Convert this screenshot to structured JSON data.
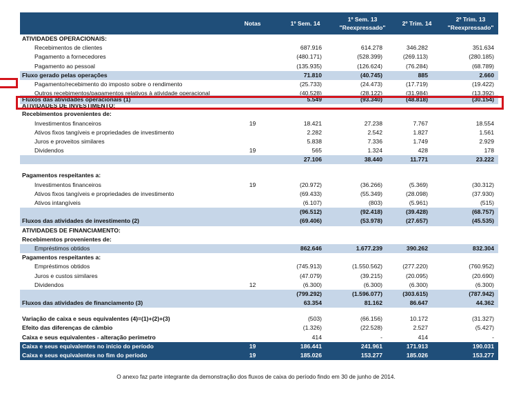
{
  "header": {
    "notes": "Notas",
    "c1": "1º Sem. 14",
    "c2_line1": "1º Sem. 13",
    "c2_line2": "\"Reexpressado\"",
    "c3": "2º Trim. 14",
    "c4_line1": "2º Trim. 13",
    "c4_line2": "\"Reexpressado\""
  },
  "rows": [
    {
      "style": "h",
      "label": "ATIVIDADES OPERACIONAIS:",
      "notes": "",
      "v": [
        "",
        "",
        "",
        ""
      ]
    },
    {
      "style": "",
      "indent": true,
      "label": "Recebimentos de clientes",
      "notes": "",
      "v": [
        "687.916",
        "614.278",
        "346.282",
        "351.634"
      ]
    },
    {
      "style": "",
      "indent": true,
      "label": "Pagamento a fornecedores",
      "notes": "",
      "v": [
        "(480.171)",
        "(528.399)",
        "(269.113)",
        "(280.185)"
      ]
    },
    {
      "style": "",
      "indent": true,
      "label": "Pagamento ao pessoal",
      "notes": "",
      "v": [
        "(135.935)",
        "(126.624)",
        "(76.284)",
        "(68.789)"
      ]
    },
    {
      "style": "b",
      "label": "Fluxo gerado pelas operações",
      "notes": "",
      "v": [
        "71.810",
        "(40.745)",
        "885",
        "2.660"
      ]
    },
    {
      "style": "",
      "indent": true,
      "label": "Pagamento/recebimento do imposto sobre o rendimento",
      "notes": "",
      "v": [
        "(25.733)",
        "(24.473)",
        "(17.719)",
        "(19.422)"
      ]
    },
    {
      "style": "clip",
      "indent": true,
      "label": "Outros recebimentos/pagamentos relativos à atividade operacional",
      "notes": "",
      "v": [
        "(40.528)",
        "(28.122)",
        "(31.984)",
        "(13.392)"
      ]
    },
    {
      "style": "b",
      "label": "Fluxos das atividades operacionais (1)",
      "notes": "",
      "v": [
        "5.549",
        "(93.340)",
        "(48.818)",
        "(30.154)"
      ]
    },
    {
      "style": "clip2",
      "label": "ATIVIDADES DE INVESTIMENTO:",
      "notes": "",
      "v": [
        "",
        "",
        "",
        ""
      ]
    },
    {
      "style": "h",
      "label": "Recebimentos provenientes de:",
      "notes": "",
      "v": [
        "",
        "",
        "",
        ""
      ]
    },
    {
      "style": "",
      "indent": true,
      "label": "Investimentos financeiros",
      "notes": "19",
      "v": [
        "18.421",
        "27.238",
        "7.767",
        "18.554"
      ]
    },
    {
      "style": "",
      "indent": true,
      "label": "Ativos fixos tangíveis e propriedades de investimento",
      "notes": "",
      "v": [
        "2.282",
        "2.542",
        "1.827",
        "1.561"
      ]
    },
    {
      "style": "",
      "indent": true,
      "label": "Juros e proveitos similares",
      "notes": "",
      "v": [
        "5.838",
        "7.336",
        "1.749",
        "2.929"
      ]
    },
    {
      "style": "",
      "indent": true,
      "label": "Dividendos",
      "notes": "19",
      "v": [
        "565",
        "1.324",
        "428",
        "178"
      ]
    },
    {
      "style": "b",
      "label": "",
      "notes": "",
      "v": [
        "27.106",
        "38.440",
        "11.771",
        "23.222"
      ]
    },
    {
      "style": "gap",
      "label": "",
      "notes": "",
      "v": [
        "",
        "",
        "",
        ""
      ]
    },
    {
      "style": "h",
      "label": "Pagamentos respeitantes a:",
      "notes": "",
      "v": [
        "",
        "",
        "",
        ""
      ]
    },
    {
      "style": "",
      "indent": true,
      "label": "Investimentos financeiros",
      "notes": "19",
      "v": [
        "(20.972)",
        "(36.266)",
        "(5.369)",
        "(30.312)"
      ]
    },
    {
      "style": "",
      "indent": true,
      "label": "Ativos fixos tangíveis e propriedades de investimento",
      "notes": "",
      "v": [
        "(69.433)",
        "(55.349)",
        "(28.098)",
        "(37.930)"
      ]
    },
    {
      "style": "",
      "indent": true,
      "label": "Ativos intangíveis",
      "notes": "",
      "v": [
        "(6.107)",
        "(803)",
        "(5.961)",
        "(515)"
      ]
    },
    {
      "style": "b",
      "label": "",
      "notes": "",
      "v": [
        "(96.512)",
        "(92.418)",
        "(39.428)",
        "(68.757)"
      ]
    },
    {
      "style": "b",
      "label": "Fluxos das atividades de investimento (2)",
      "notes": "",
      "v": [
        "(69.406)",
        "(53.978)",
        "(27.657)",
        "(45.535)"
      ]
    },
    {
      "style": "h",
      "label": "ATIVIDADES DE FINANCIAMENTO:",
      "notes": "",
      "v": [
        "",
        "",
        "",
        ""
      ]
    },
    {
      "style": "h",
      "label": "Recebimentos provenientes de:",
      "notes": "",
      "v": [
        "",
        "",
        "",
        ""
      ]
    },
    {
      "style": "b",
      "indent": true,
      "label": "Empréstimos obtidos",
      "notes": "",
      "v": [
        "862.646",
        "1.677.239",
        "390.262",
        "832.304"
      ],
      "normalLabel": true
    },
    {
      "style": "h",
      "label": "Pagamentos respeitantes a:",
      "notes": "",
      "v": [
        "",
        "",
        "",
        ""
      ]
    },
    {
      "style": "",
      "indent": true,
      "label": "Empréstimos obtidos",
      "notes": "",
      "v": [
        "(745.913)",
        "(1.550.562)",
        "(277.220)",
        "(760.952)"
      ]
    },
    {
      "style": "",
      "indent": true,
      "label": "Juros e custos similares",
      "notes": "",
      "v": [
        "(47.079)",
        "(39.215)",
        "(20.095)",
        "(20.690)"
      ]
    },
    {
      "style": "",
      "indent": true,
      "label": "Dividendos",
      "notes": "12",
      "v": [
        "(6.300)",
        "(6.300)",
        "(6.300)",
        "(6.300)"
      ]
    },
    {
      "style": "b",
      "label": "",
      "notes": "",
      "v": [
        "(799.292)",
        "(1.596.077)",
        "(303.615)",
        "(787.942)"
      ]
    },
    {
      "style": "b",
      "label": "Fluxos das atividades de financiamento (3)",
      "notes": "",
      "v": [
        "63.354",
        "81.162",
        "86.647",
        "44.362"
      ]
    },
    {
      "style": "gap",
      "label": "",
      "notes": "",
      "v": [
        "",
        "",
        "",
        ""
      ]
    },
    {
      "style": "h",
      "label": "Variação de caixa e seus equivalentes   (4)=(1)+(2)+(3)",
      "notes": "",
      "v": [
        "(503)",
        "(66.156)",
        "10.172",
        "(31.327)"
      ],
      "plainValues": true
    },
    {
      "style": "h",
      "label": "Efeito das diferenças de câmbio",
      "notes": "",
      "v": [
        "(1.326)",
        "(22.528)",
        "2.527",
        "(5.427)"
      ],
      "plainValues": true
    },
    {
      "style": "h",
      "label": "Caixa e seus equivalentes - alteração perímetro",
      "notes": "",
      "v": [
        "414",
        "-",
        "414",
        "-"
      ],
      "plainValues": true
    },
    {
      "style": "d",
      "label": "Caixa e seus equivalentes no início do período",
      "notes": "19",
      "v": [
        "186.441",
        "241.961",
        "171.913",
        "190.031"
      ]
    },
    {
      "style": "d",
      "label": "Caixa e seus equivalentes no fim do período",
      "notes": "19",
      "v": [
        "185.026",
        "153.277",
        "185.026",
        "153.277"
      ]
    }
  ],
  "footer": "O anexo faz parte integrante da demonstração dos fluxos de caixa  do período findo em 30 de junho de 2014.",
  "colors": {
    "header": "#1f4e79",
    "band": "#c6d6e8",
    "highlight": "#d4141c"
  }
}
